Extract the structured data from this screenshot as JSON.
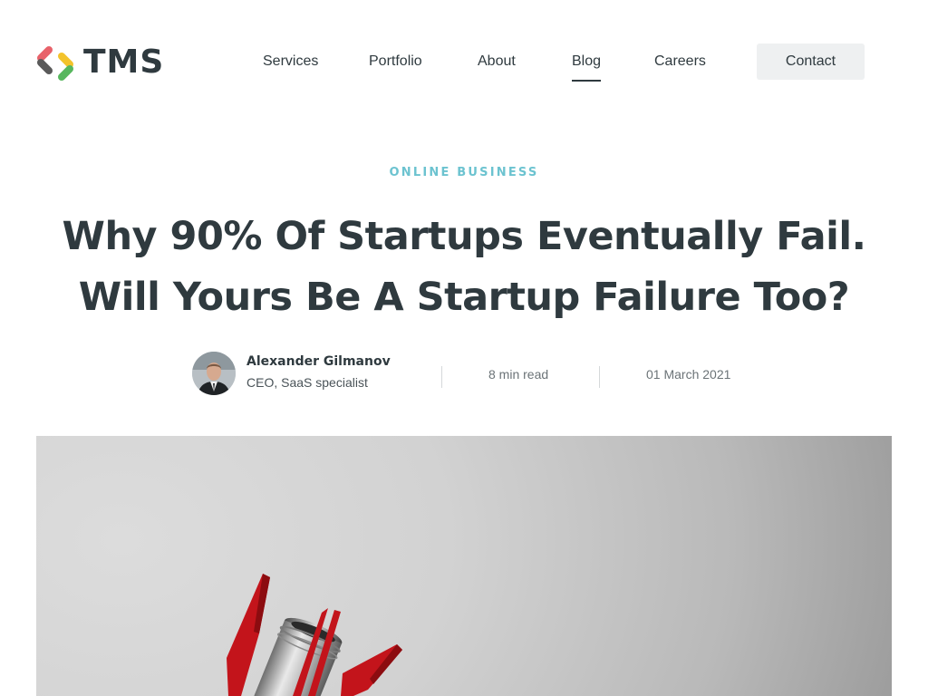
{
  "brand": {
    "name": "TMS"
  },
  "nav": {
    "items": [
      {
        "label": "Services"
      },
      {
        "label": "Portfolio"
      },
      {
        "label": "About"
      },
      {
        "label": "Blog",
        "active": true
      },
      {
        "label": "Careers"
      }
    ],
    "contact_label": "Contact"
  },
  "article": {
    "category": "ONLINE BUSINESS",
    "title": "Why 90% Of Startups Eventually Fail. Will Yours Be A Startup Failure Too?",
    "author": {
      "name": "Alexander Gilmanov",
      "role": "CEO, SaaS specialist"
    },
    "read_time": "8 min read",
    "date": "01 March 2021",
    "hero_image": "rocket-image"
  },
  "colors": {
    "accent": "#6cc3d0",
    "text": "#2f3a3f",
    "button_bg": "#eef0f1",
    "logo_red": "#e8626a",
    "logo_yellow": "#f3c32c",
    "logo_green": "#57b75e",
    "logo_dark": "#5a5a5a"
  }
}
